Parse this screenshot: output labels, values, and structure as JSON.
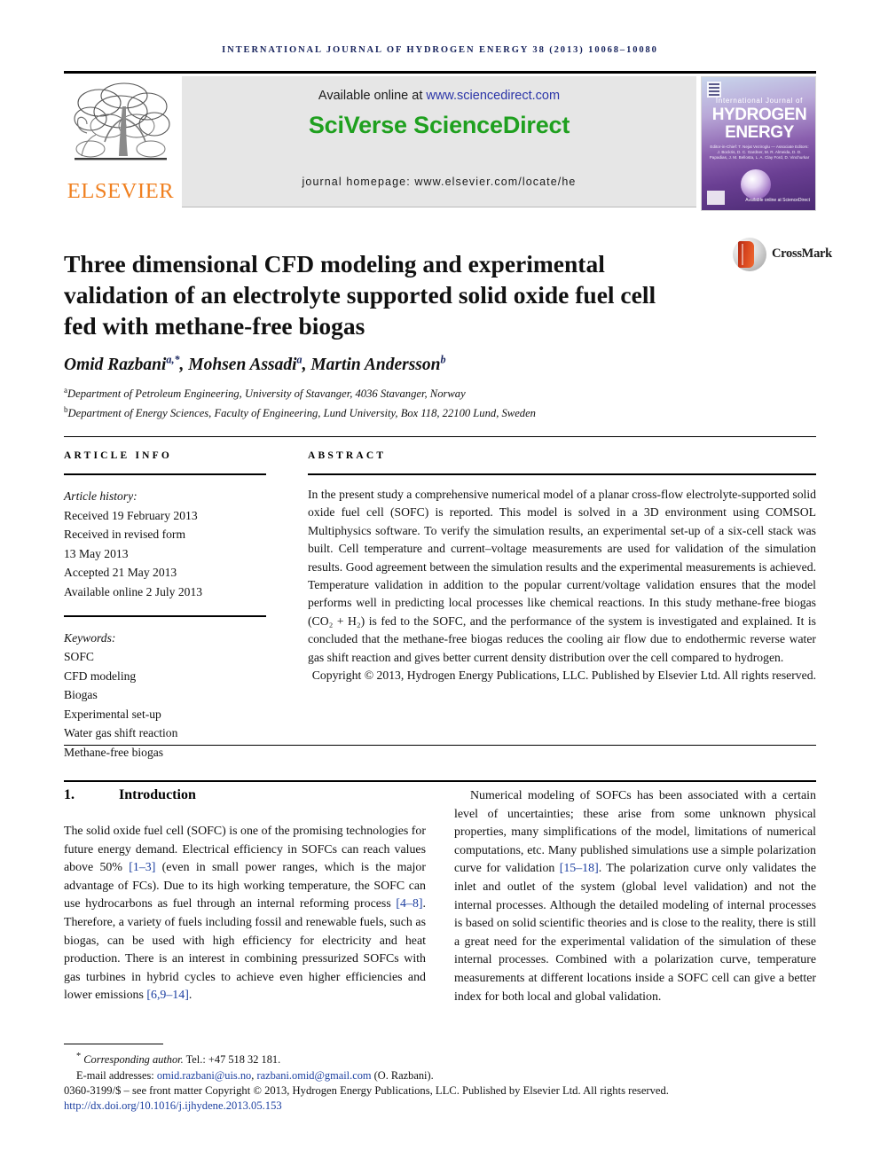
{
  "running_head": "international journal of hydrogen energy 38 (2013) 10068–10080",
  "masthead": {
    "publisher_logo_name": "elsevier-tree-logo",
    "publisher_wordmark": "ELSEVIER",
    "available_prefix": "Available online at ",
    "available_url": "www.sciencedirect.com",
    "platform_title": "SciVerse ScienceDirect",
    "homepage_line": "journal homepage: www.elsevier.com/locate/he",
    "cover": {
      "elsevier_mark": "elsevier-mark-icon",
      "kicker": "International Journal of",
      "line1": "HYDROGEN",
      "line2": "ENERGY",
      "editors": "Editor-in-Chief: T. Nejat Veziroglu — Associate Editors: J. Bockris, D. C. Gardner, M. R. Almeida, D. D. Papadias, J. M. Bellosta, L. A. Clay Ford, D. Vinchurkar",
      "sciencedirect_mark": "Available online at ScienceDirect"
    }
  },
  "article": {
    "title": "Three dimensional CFD modeling and experimental validation of an electrolyte supported solid oxide fuel cell fed with methane-free biogas",
    "crossmark_label": "CrossMark",
    "authors_html": "Omid Razbani<sup>a,*</sup>, Mohsen Assadi<sup>a</sup>, Martin Andersson<sup>b</sup>",
    "affiliation_a": "Department of Petroleum Engineering, University of Stavanger, 4036 Stavanger, Norway",
    "affiliation_b": "Department of Energy Sciences, Faculty of Engineering, Lund University, Box 118, 22100 Lund, Sweden",
    "affil_a_marker": "a",
    "affil_b_marker": "b"
  },
  "article_info": {
    "heading": "ARTICLE INFO",
    "history_label": "Article history:",
    "history": [
      "Received 19 February 2013",
      "Received in revised form",
      "13 May 2013",
      "Accepted 21 May 2013",
      "Available online 2 July 2013"
    ],
    "keywords_label": "Keywords:",
    "keywords": [
      "SOFC",
      "CFD modeling",
      "Biogas",
      "Experimental set-up",
      "Water gas shift reaction",
      "Methane-free biogas"
    ]
  },
  "abstract": {
    "heading": "ABSTRACT",
    "body": "In the present study a comprehensive numerical model of a planar cross-flow electrolyte-supported solid oxide fuel cell (SOFC) is reported. This model is solved in a 3D environment using COMSOL Multiphysics software. To verify the simulation results, an experimental set-up of a six-cell stack was built. Cell temperature and current–voltage measurements are used for validation of the simulation results. Good agreement between the simulation results and the experimental measurements is achieved. Temperature validation in addition to the popular current/voltage validation ensures that the model performs well in predicting local processes like chemical reactions. In this study methane-free biogas (CO₂ + H₂) is fed to the SOFC, and the performance of the system is investigated and explained. It is concluded that the methane-free biogas reduces the cooling air flow due to endothermic reverse water gas shift reaction and gives better current density distribution over the cell compared to hydrogen.",
    "copyright": "Copyright © 2013, Hydrogen Energy Publications, LLC. Published by Elsevier Ltd. All rights reserved."
  },
  "sections": {
    "intro_number": "1.",
    "intro_title": "Introduction",
    "left_para_1": "The solid oxide fuel cell (SOFC) is one of the promising technologies for future energy demand. Electrical efficiency in SOFCs can reach values above 50% ",
    "left_ref_1": "[1–3]",
    "left_para_2": " (even in small power ranges, which is the major advantage of FCs). Due to its high working temperature, the SOFC can use hydrocarbons as fuel through an internal reforming process ",
    "left_ref_2": "[4–8]",
    "left_para_3": ". Therefore, a variety of fuels including fossil and renewable fuels, such as biogas, can be used with high efficiency for electricity and heat production. There is an interest in combining pressurized SOFCs with gas turbines in hybrid cycles to achieve even higher efficiencies and lower emissions ",
    "left_ref_3": "[6,9–14]",
    "left_para_4": ".",
    "right_para_1": "Numerical modeling of SOFCs has been associated with a certain level of uncertainties; these arise from some unknown physical properties, many simplifications of the model, limitations of numerical computations, etc. Many published simulations use a simple polarization curve for validation ",
    "right_ref_1": "[15–18]",
    "right_para_2": ". The polarization curve only validates the inlet and outlet of the system (global level validation) and not the internal processes. Although the detailed modeling of internal processes is based on solid scientific theories and is close to the reality, there is still a great need for the experimental validation of the simulation of these internal processes. Combined with a polarization curve, temperature measurements at different locations inside a SOFC cell can give a better index for both local and global validation."
  },
  "footer": {
    "corresponding_marker": "*",
    "corresponding_label": "Corresponding author.",
    "corresponding_tel": " Tel.: +47 518 32 181.",
    "email_label": "E-mail addresses: ",
    "email_1": "omid.razbani@uis.no",
    "email_sep": ", ",
    "email_2": "razbani.omid@gmail.com",
    "email_attrib": " (O. Razbani).",
    "issn_line": "0360-3199/$ – see front matter Copyright © 2013, Hydrogen Energy Publications, LLC. Published by Elsevier Ltd. All rights reserved.",
    "doi": "http://dx.doi.org/10.1016/j.ijhydene.2013.05.153"
  },
  "colors": {
    "running_head": "#16225c",
    "sciencedirect_green": "#1fa01f",
    "link_blue": "#2b35a8",
    "reference_blue": "#1c3fa0",
    "elsevier_orange": "#f08020"
  }
}
